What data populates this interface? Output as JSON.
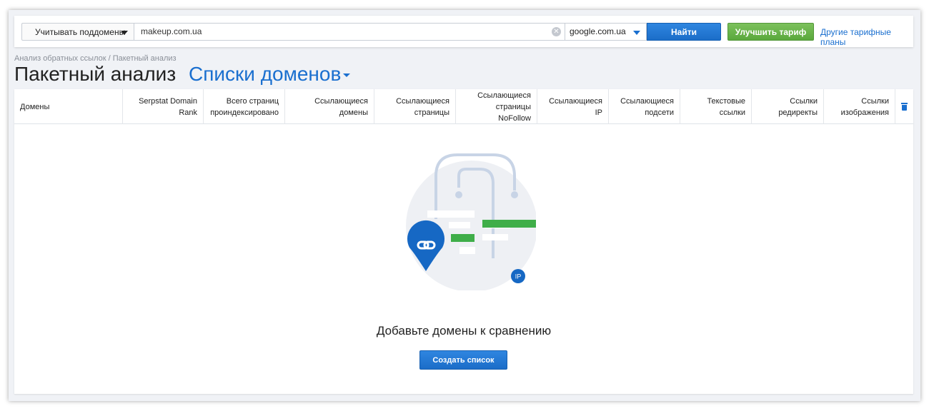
{
  "search": {
    "subdomain_label": "Учитывать поддомены",
    "domain_value": "makeup.com.ua",
    "engine_value": "google.com.ua",
    "find_label": "Найти",
    "upgrade_label": "Улучшить тариф",
    "other_plans_label": "Другие тарифные планы"
  },
  "breadcrumb": "Анализ обратных ссылок / Пакетный анализ",
  "title": "Пакетный анализ",
  "lists_dropdown": "Списки доменов",
  "table": {
    "columns": [
      "Домены",
      "Serpstat Domain Rank",
      "Всего страниц проиндексировано",
      "Ссылающиеся домены",
      "Ссылающиеся страницы",
      "Ссылающиеся страницы NoFollow",
      "Ссылающиеся IP",
      "Ссылающиеся подсети",
      "Текстовые ссылки",
      "Ссылки редиректы",
      "Ссылки изображения"
    ]
  },
  "empty": {
    "message": "Добавьте домены к сравнению",
    "create_label": "Создать список",
    "ip_badge": "IP"
  },
  "colors": {
    "accent": "#1a6fcf",
    "green": "#5aa83c",
    "illustration_green": "#3fae49"
  },
  "icons": [
    "chevron-down-icon",
    "clear-icon",
    "trash-icon",
    "link-pin-icon"
  ]
}
